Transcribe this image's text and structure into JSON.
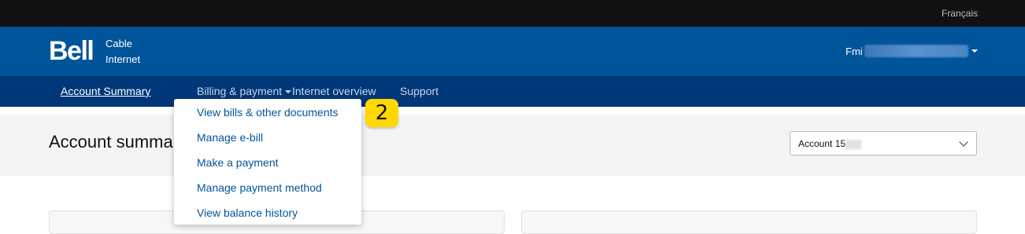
{
  "topbar": {
    "language_link": "Français"
  },
  "header": {
    "logo": "Bell",
    "logo_sub_line1": "Cable",
    "logo_sub_line2": "Internet",
    "user_name": "Fmi"
  },
  "nav": {
    "items": [
      {
        "label": "Account Summary"
      },
      {
        "label": "Billing & payment"
      },
      {
        "label": "Internet overview"
      },
      {
        "label": "Support"
      }
    ]
  },
  "page": {
    "title": "Account summary",
    "account_select": "Account 15"
  },
  "dropdown": {
    "items": [
      {
        "label": "View bills & other documents"
      },
      {
        "label": "Manage e-bill"
      },
      {
        "label": "Make a payment"
      },
      {
        "label": "Manage payment method"
      },
      {
        "label": "View balance history"
      }
    ]
  },
  "annotation": {
    "step": "2"
  },
  "colors": {
    "brand_blue": "#00549a",
    "nav_dark": "#003778",
    "badge_yellow": "#ffd800"
  }
}
